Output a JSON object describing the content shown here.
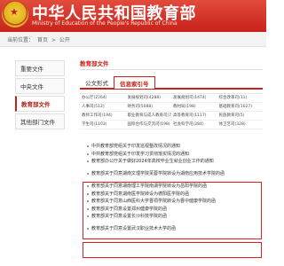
{
  "header": {
    "title": "中华人民共和国教育部",
    "subtitle": "Ministry of Education of the People's Republic of China",
    "accent_color": "#c8221c"
  },
  "breadcrumb": {
    "items": [
      "当前位置：",
      "首页",
      ">",
      "公开"
    ]
  },
  "sidebar": {
    "items": [
      {
        "label": "重要文件",
        "active": false
      },
      {
        "label": "中央文件",
        "active": false
      },
      {
        "label": "教育部文件",
        "active": true
      },
      {
        "label": "其他部门文件",
        "active": false
      }
    ]
  },
  "main": {
    "section_title": "教育部文件",
    "tabs": [
      {
        "label": "公文形式",
        "active": false
      },
      {
        "label": "信息索引号",
        "active": true
      }
    ],
    "table_rows": [
      [
        "办公厅(2764)",
        "发展规划司(4288)",
        "发展规划司(1474)",
        "综合改革司(11)"
      ],
      [
        "人事司(512)",
        "财务司(5088)",
        "教材局(198)",
        "基础教育司(1027)"
      ],
      [
        "教师工作司(194)",
        "职业教育与成人教育司(792)",
        "高等教育司(1117)",
        "民族教育司(5)"
      ],
      [
        "学生司(1103)",
        "国际合作与交流司(198)",
        "社会科学司(284)",
        "体卫艺司(328)"
      ]
    ]
  },
  "list": {
    "items": [
      "中共教育部党组关于印发巡视整改情况的通知",
      "中共教育部党组关于印发学习贯彻落实情况的通知",
      "教育部办公厅关于做好2024年高校毕业生就业创业工作的通知",
      "教育部关于同意湖南文理学院芙蓉学院转设为湖南应用技术学院的函",
      "教育部关于同意湖南理工学院南湖学院转设为岳阳学院的函",
      "教育部关于同意湖南医学院转设为德阳医学院的函",
      "教育部关于同意山西医科大学晋祠学院转设为晋中健康学院的函",
      "教育部关于同意设置郑州健康学院的函",
      "教育部关于同意设置长沙科技学院的函",
      "教育部关于同意设置武汉职业技术大学的函"
    ]
  }
}
